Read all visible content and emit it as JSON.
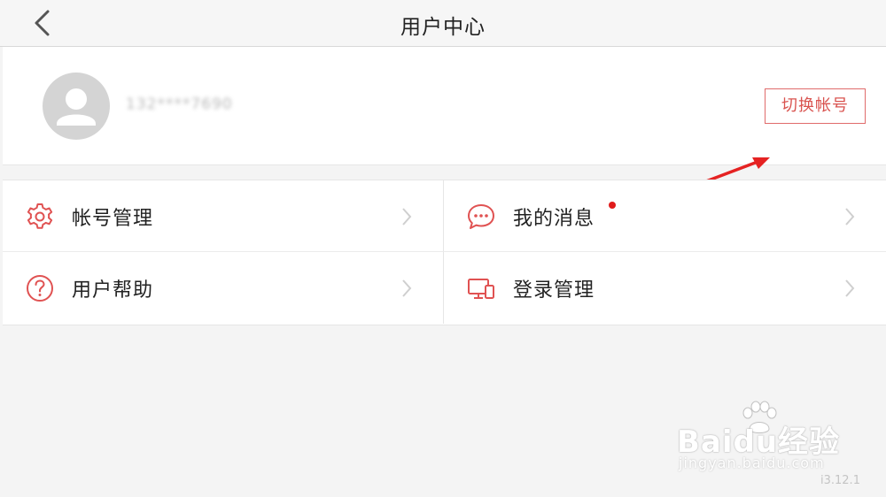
{
  "header": {
    "title": "用户中心",
    "back_icon": "chevron-left-icon"
  },
  "profile": {
    "avatar_icon": "user-avatar-icon",
    "phone": "132****7690",
    "switch_account_label": "切换帐号"
  },
  "menu": {
    "items": [
      {
        "label": "帐号管理",
        "icon": "gear-icon",
        "has_dot": false
      },
      {
        "label": "我的消息",
        "icon": "chat-bubble-icon",
        "has_dot": true
      },
      {
        "label": "用户帮助",
        "icon": "question-circle-icon",
        "has_dot": false
      },
      {
        "label": "登录管理",
        "icon": "devices-icon",
        "has_dot": false
      }
    ]
  },
  "watermark": {
    "main": "Baidu经验",
    "sub": "jingyan.baidu.com"
  },
  "version": "i3.12.1",
  "colors": {
    "accent": "#d9534f",
    "icon": "#e05252",
    "badge": "#e01b1b",
    "background": "#f4f4f4"
  }
}
